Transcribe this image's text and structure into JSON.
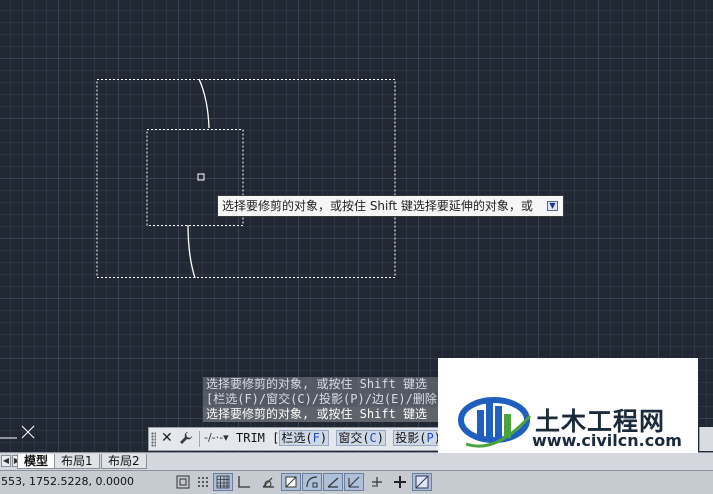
{
  "tooltip": {
    "text": "选择要修剪的对象，或按住 Shift 键选择要延伸的对象，或"
  },
  "history": {
    "lines": [
      "选择要修剪的对象, 或按住 Shift 键选",
      "[栏选(F)/窗交(C)/投影(P)/边(E)/删除",
      "选择要修剪的对象, 或按住 Shift 键选"
    ]
  },
  "command_bar": {
    "dropdown_glyph": "-/-·-",
    "command": "TRIM",
    "bracket": "[",
    "options": [
      {
        "label": "栏选(",
        "key": "F",
        "close": ")"
      },
      {
        "label": "窗交(",
        "key": "C",
        "close": ")"
      },
      {
        "label": "投影(",
        "key": "P",
        "close": ")"
      }
    ]
  },
  "tabs": {
    "items": [
      "模型",
      "布局1",
      "布局2"
    ],
    "active": "模型"
  },
  "status": {
    "coords": "553,  1752.5228,  0.0000",
    "buttons": [
      "model-space",
      "snap-grid",
      "grid-display",
      "ortho",
      "polar",
      "object-snap",
      "object-snap-tracking",
      "2d-osnap",
      "dynamic-ucs",
      "dynamic-input",
      "lineweight",
      "transparency"
    ]
  },
  "watermark": {
    "title": "土木工程网",
    "url": "www.civilcn.com"
  },
  "colors": {
    "canvas": "#212834",
    "watermark_blue": "#1f5fbf",
    "watermark_green": "#4aa33c"
  }
}
